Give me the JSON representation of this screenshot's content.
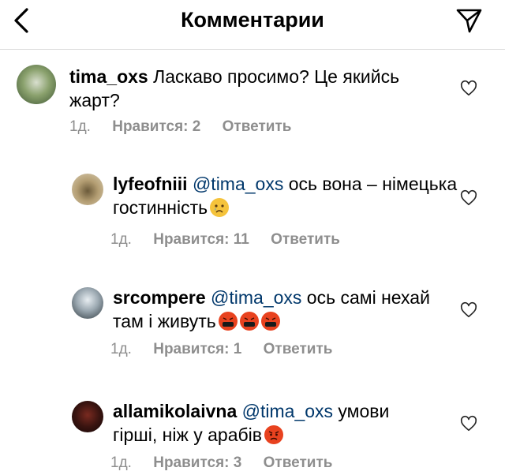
{
  "header": {
    "title": "Комментарии"
  },
  "comments": [
    {
      "username": "tima_oxs",
      "text_line1": "Ласкаво просимо? Це якийсь",
      "text_line2": "жарт?",
      "time": "1д.",
      "likes": "Нравится: 2",
      "reply": "Ответить"
    },
    {
      "username": "lyfeofniii",
      "mention": "@tima_oxs",
      "text_line1": "ось вона – німецька",
      "text_line2": "гостинність",
      "emoji": [
        "crying-face"
      ],
      "time": "1д.",
      "likes": "Нравится: 11",
      "reply": "Ответить"
    },
    {
      "username": "srcompere",
      "mention": "@tima_oxs",
      "text_line1": "ось самі нехай",
      "text_line2": "там і живуть",
      "emoji": [
        "cursing-face",
        "cursing-face",
        "cursing-face"
      ],
      "time": "1д.",
      "likes": "Нравится: 1",
      "reply": "Ответить"
    },
    {
      "username": "allamikolaivna",
      "mention": "@tima_oxs",
      "text_line1": "умови",
      "text_line2": "гірші, ніж у арабів",
      "emoji": [
        "pouting-face"
      ],
      "time": "1д.",
      "likes": "Нравится: 3",
      "reply": "Ответить"
    }
  ],
  "colors": {
    "mention": "#00376b",
    "meta": "#8e8e8e",
    "angry": "#e8421f",
    "sad": "#f5c33b"
  }
}
